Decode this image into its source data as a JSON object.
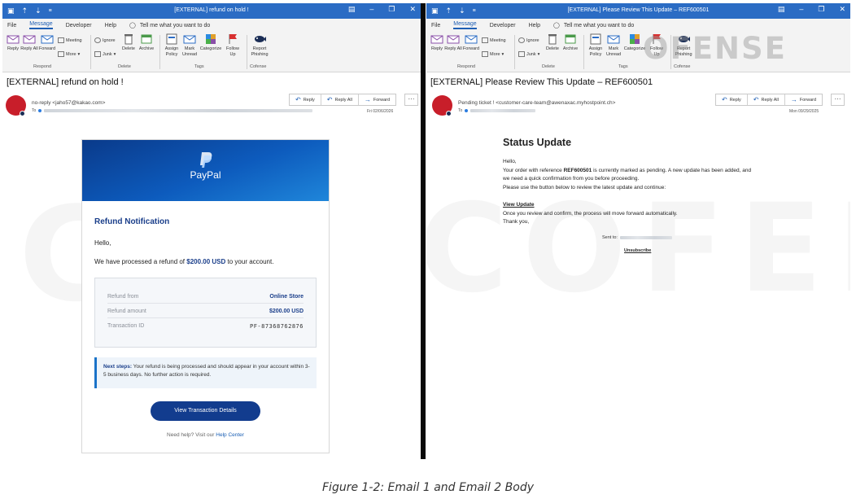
{
  "window1": {
    "title": "[EXTERNAL] refund on hold !",
    "menu": [
      "File",
      "Message",
      "Developer",
      "Help"
    ],
    "tell_me": "Tell me what you want to do",
    "ribbon": {
      "reply": "Reply",
      "reply_all": "Reply All",
      "forward": "Forward",
      "meeting": "Meeting",
      "more": "More",
      "ignore": "Ignore",
      "junk": "Junk",
      "delete": "Delete",
      "archive": "Archive",
      "assign_policy": "Assign Policy",
      "mark_unread": "Mark Unread",
      "categorize": "Categorize",
      "follow_up": "Follow Up",
      "report_phishing": "Report Phishing",
      "groups": [
        "Respond",
        "Delete",
        "Tags",
        "Cofense"
      ]
    },
    "subject": "[EXTERNAL] refund on hold !",
    "sender": "no-reply <jaho57@kakao.com>",
    "to_label": "To",
    "date": "Fri 02/06/2026",
    "actions": [
      "Reply",
      "Reply All",
      "Forward"
    ],
    "more": "···",
    "body": {
      "brand": "PayPal",
      "heading": "Refund Notification",
      "greeting": "Hello,",
      "line_prefix": "We have processed a refund of ",
      "amount": "$200.00 USD",
      "line_suffix": " to your account.",
      "details": [
        {
          "label": "Refund from",
          "value": "Online Store"
        },
        {
          "label": "Refund amount",
          "value": "$200.00 USD"
        },
        {
          "label": "Transaction ID",
          "value": "PF-87368762876"
        }
      ],
      "next_steps_label": "Next steps:",
      "next_steps_text": " Your refund is being processed and should appear in your account within 3-5 business days. No further action is required.",
      "button": "View Transaction Details",
      "help_prefix": "Need help? Visit our ",
      "help_link": "Help Center"
    }
  },
  "window2": {
    "title": "[EXTERNAL] Please Review This Update – REF600501",
    "menu": [
      "File",
      "Message",
      "Developer",
      "Help"
    ],
    "tell_me": "Tell me what you want to do",
    "ribbon": {
      "reply": "Reply",
      "reply_all": "Reply All",
      "forward": "Forward",
      "meeting": "Meeting",
      "more": "More",
      "ignore": "Ignore",
      "junk": "Junk",
      "delete": "Delete",
      "archive": "Archive",
      "assign_policy": "Assign Policy",
      "mark_unread": "Mark Unread",
      "categorize": "Categorize",
      "follow_up": "Follow Up",
      "report_phishing": "Report Phishing",
      "groups": [
        "Respond",
        "Delete",
        "Tags",
        "Cofense"
      ]
    },
    "subject": "[EXTERNAL] Please Review This Update – REF600501",
    "sender": "Pending ticket ! <customer-care-team@awenaxac.myhostpoint.ch>",
    "to_label": "To",
    "date": "Mon 09/29/2025",
    "actions": [
      "Reply",
      "Reply All",
      "Forward"
    ],
    "more": "···",
    "body": {
      "heading": "Status Update",
      "greeting": "Hello,",
      "line1_prefix": "Your order with reference ",
      "reference": "REF600501",
      "line1_suffix": " is currently marked as pending. A new update has been added, and",
      "line2": "we need a quick confirmation from you before proceeding.",
      "line3": "Please use the button below to review the latest update and continue:",
      "link": "View Update",
      "line4": "Once you review and confirm, the process will move forward automatically.",
      "thanks": "Thank you,",
      "sent_to": "Sent to:",
      "unsubscribe": "Unsubscribe"
    },
    "logo": "OFENSE"
  },
  "watermark": "COFENSE",
  "caption": "Figure 1-2: Email 1 and Email 2 Body",
  "colors": {
    "titlebar": "#2b6cc4",
    "paypal_blue": "#123c8e",
    "avatar": "#c81e2a",
    "accent": "#1f5fb4"
  }
}
